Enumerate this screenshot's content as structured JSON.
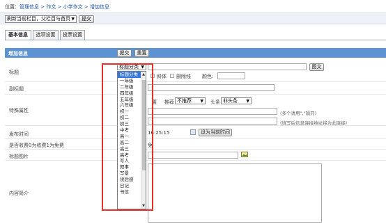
{
  "location": {
    "label": "位置：",
    "path": "管理信息 > 作文 > 小学作文 > 增加信息"
  },
  "toolbar": {
    "refresh_option": "刷新当前栏目，父栏目与首页",
    "submit": "提交"
  },
  "tabs": [
    "基本信息",
    "选项设置",
    "投票设置"
  ],
  "header": {
    "title": "增加信息",
    "submit": "提交",
    "reset": "重置"
  },
  "form": {
    "title_label": "标题",
    "title_category_select": "标题分类",
    "image_button": "图文",
    "italic_label": "斜体",
    "strike_label": "删除线",
    "color_label": "颜色:",
    "subtitle_label": "副标题",
    "special_label": "特殊属性",
    "top_fragment": "置顶",
    "recommend_label": "推荐",
    "recommend_value": "不推荐",
    "headline_label": "头条",
    "headline_value": "非头条",
    "keyword_hint": "(多个请用\",\"隔开)",
    "link_hint": "(填写后信息连接地址将为此链接)",
    "date_label": "发布时间",
    "date_value": "16:25:15",
    "set_now_button": "设为当前时间",
    "charge_label": "是否收费0为收费1为免费",
    "charge_fragment": "免费",
    "image_label": "标题图片",
    "summary_label": "内容简介"
  },
  "dropdown": {
    "items": [
      "标题分类",
      "一年级",
      "二年级",
      "四年级",
      "五年级",
      "六年级",
      "初一",
      "初二",
      "初三",
      "中考",
      "高一",
      "高二",
      "高三",
      "高考",
      "写人",
      "叙事",
      "写景",
      "读后感",
      "日记",
      "书信"
    ],
    "selected_index": 0
  },
  "colors": {
    "accent": "#4a86c8",
    "highlight": "#e8302a",
    "header_bg": "#5b93d3"
  }
}
